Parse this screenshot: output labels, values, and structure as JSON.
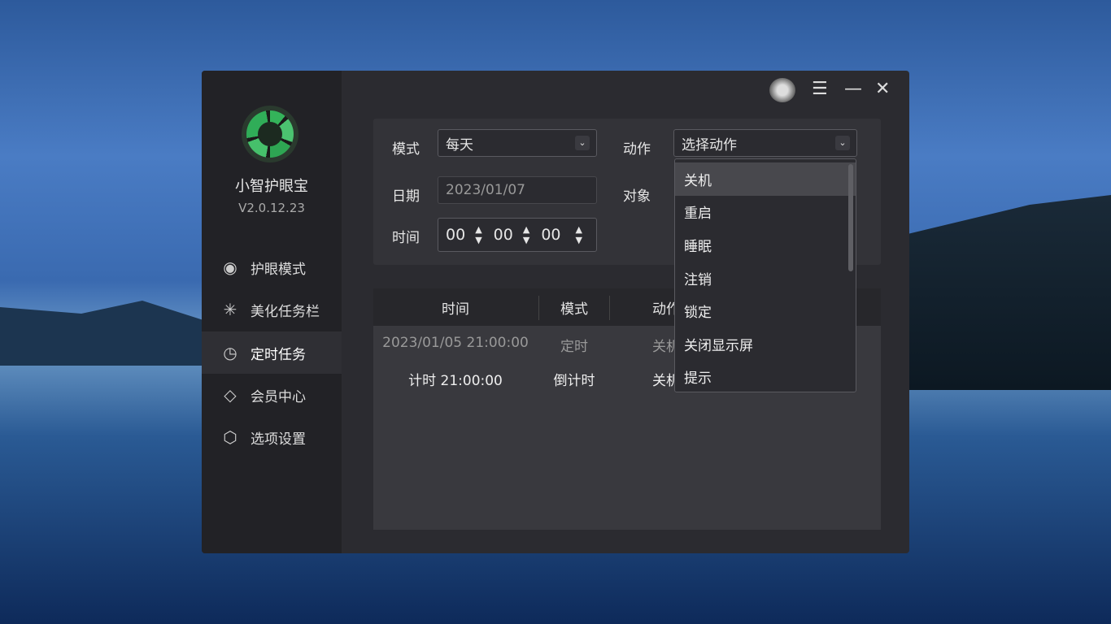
{
  "app": {
    "name": "小智护眼宝",
    "version": "V2.0.12.23"
  },
  "titlebar": {
    "menu_icon": "☰",
    "minimize_icon": "—",
    "close_icon": "✕"
  },
  "sidebar": {
    "items": [
      {
        "label": "护眼模式",
        "icon": "eye-icon"
      },
      {
        "label": "美化任务栏",
        "icon": "sparkle-icon"
      },
      {
        "label": "定时任务",
        "icon": "clock-icon"
      },
      {
        "label": "会员中心",
        "icon": "diamond-icon"
      },
      {
        "label": "选项设置",
        "icon": "settings-icon"
      }
    ],
    "active": 2
  },
  "form": {
    "mode_label": "模式",
    "mode_value": "每天",
    "action_label": "动作",
    "action_value": "选择动作",
    "date_label": "日期",
    "date_value": "2023/01/07",
    "target_label": "对象",
    "time_label": "时间",
    "time_h": "00",
    "time_m": "00",
    "time_s": "00"
  },
  "table": {
    "headers": [
      "时间",
      "模式",
      "动作"
    ],
    "rows": [
      {
        "time": "2023/01/05 21:00:00",
        "mode": "定时",
        "action": "关机"
      },
      {
        "time": "计时 21:00:00",
        "mode": "倒计时",
        "action": "关机"
      }
    ]
  },
  "dropdown": {
    "options": [
      "关机",
      "重启",
      "睡眠",
      "注销",
      "锁定",
      "关闭显示屏",
      "提示"
    ],
    "highlighted": 0
  }
}
